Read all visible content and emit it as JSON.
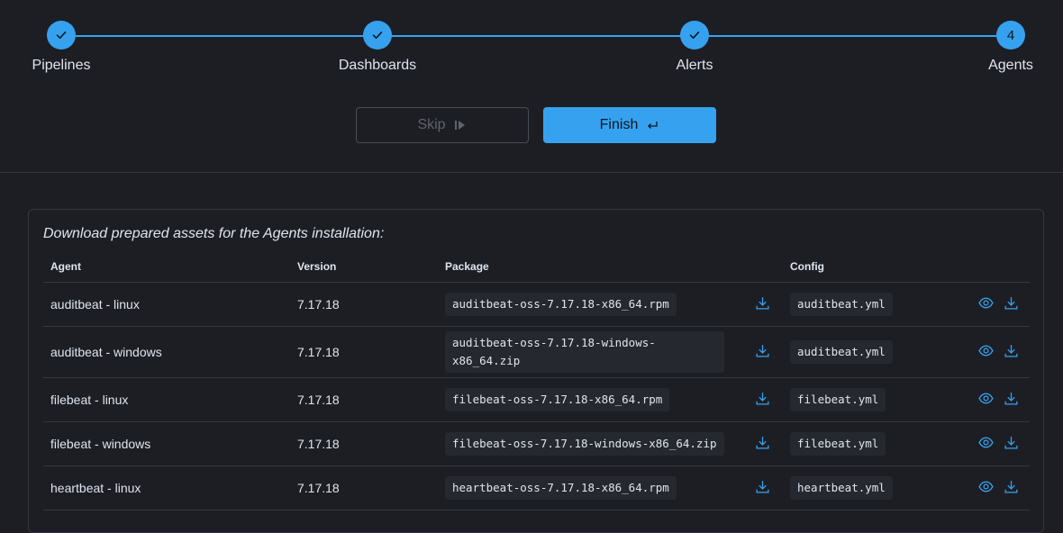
{
  "stepper": {
    "steps": [
      {
        "label": "Pipelines",
        "state": "done"
      },
      {
        "label": "Dashboards",
        "state": "done"
      },
      {
        "label": "Alerts",
        "state": "done"
      },
      {
        "label": "Agents",
        "state": "current",
        "number": "4"
      }
    ],
    "accent_color": "#36a2ef"
  },
  "buttons": {
    "skip_label": "Skip",
    "finish_label": "Finish"
  },
  "panel": {
    "title": "Download prepared assets for the Agents installation:",
    "columns": [
      "Agent",
      "Version",
      "Package",
      "Config"
    ],
    "rows": [
      {
        "agent": "auditbeat - linux",
        "version": "7.17.18",
        "package": "auditbeat-oss-7.17.18-x86_64.rpm",
        "config": "auditbeat.yml"
      },
      {
        "agent": "auditbeat - windows",
        "version": "7.17.18",
        "package": "auditbeat-oss-7.17.18-windows-x86_64.zip",
        "config": "auditbeat.yml"
      },
      {
        "agent": "filebeat - linux",
        "version": "7.17.18",
        "package": "filebeat-oss-7.17.18-x86_64.rpm",
        "config": "filebeat.yml"
      },
      {
        "agent": "filebeat - windows",
        "version": "7.17.18",
        "package": "filebeat-oss-7.17.18-windows-x86_64.zip",
        "config": "filebeat.yml"
      },
      {
        "agent": "heartbeat - linux",
        "version": "7.17.18",
        "package": "heartbeat-oss-7.17.18-x86_64.rpm",
        "config": "heartbeat.yml"
      }
    ]
  }
}
